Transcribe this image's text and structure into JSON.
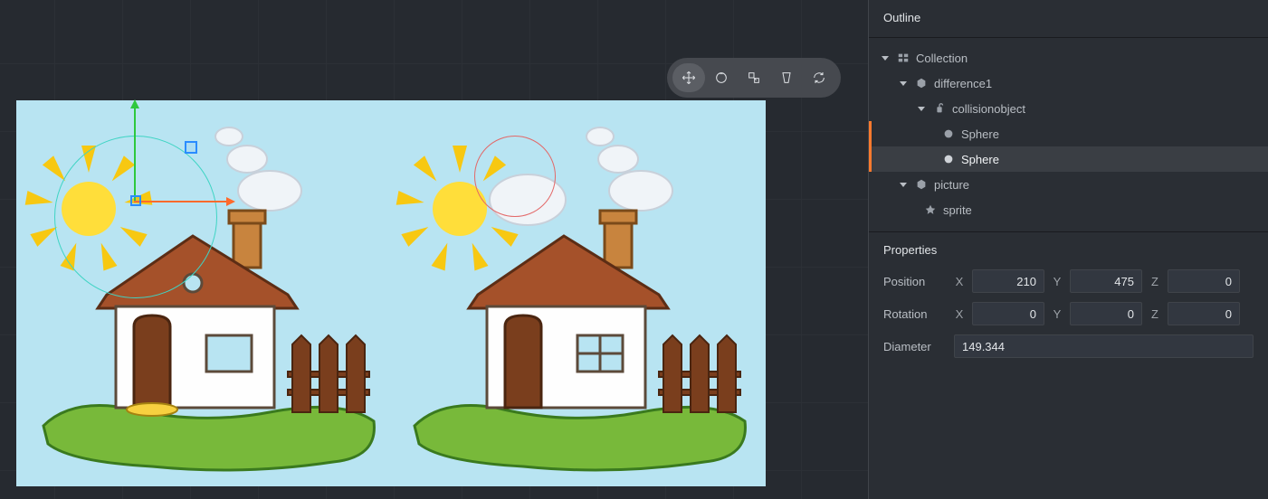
{
  "panels": {
    "outline_title": "Outline",
    "properties_title": "Properties"
  },
  "outline": {
    "collection": "Collection",
    "difference1": "difference1",
    "collisionobject": "collisionobject",
    "sphere1": "Sphere",
    "sphere2": "Sphere",
    "picture": "picture",
    "sprite": "sprite"
  },
  "properties": {
    "position_label": "Position",
    "rotation_label": "Rotation",
    "diameter_label": "Diameter",
    "x_label": "X",
    "y_label": "Y",
    "z_label": "Z",
    "position": {
      "x": "210",
      "y": "475",
      "z": "0"
    },
    "rotation": {
      "x": "0",
      "y": "0",
      "z": "0"
    },
    "diameter": "149.344"
  },
  "toolbar_icons": {
    "move": "move",
    "rotate": "rotate",
    "scale": "scale",
    "perspective": "perspective",
    "refresh": "refresh"
  }
}
